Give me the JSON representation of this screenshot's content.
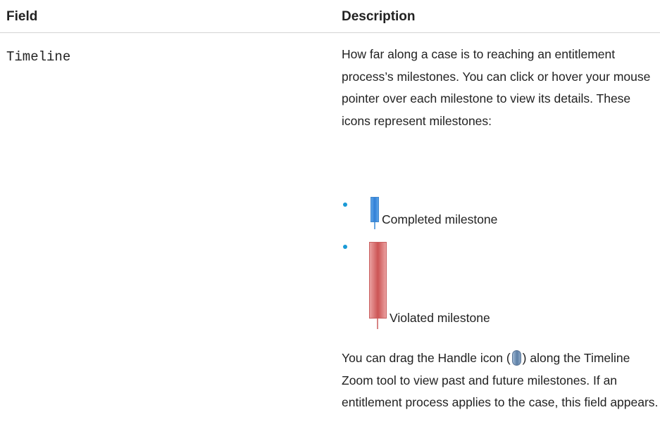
{
  "table": {
    "headers": {
      "field": "Field",
      "description": "Description"
    },
    "row": {
      "field_name": "Timeline",
      "description_intro": "How far along a case is to reaching an entitlement process’s milestones. You can click or hover your mouse pointer over each milestone to view its details. These icons represent milestones:",
      "milestones": [
        {
          "label": "Completed milestone",
          "icon": "completed-milestone-icon",
          "color": "#2f7fd6"
        },
        {
          "label": "Violated milestone",
          "icon": "violated-milestone-icon",
          "color": "#cc5454"
        }
      ],
      "drag_text_before": "You can drag the Handle icon (",
      "handle_icon": "handle-icon",
      "drag_text_after": ") along the Timeline Zoom tool to view past and future milestones. If an entitlement process applies to the case, this field appears."
    }
  },
  "colors": {
    "bullet": "#1a9ad6",
    "header_border": "#d4d4d4",
    "text": "#222222"
  }
}
